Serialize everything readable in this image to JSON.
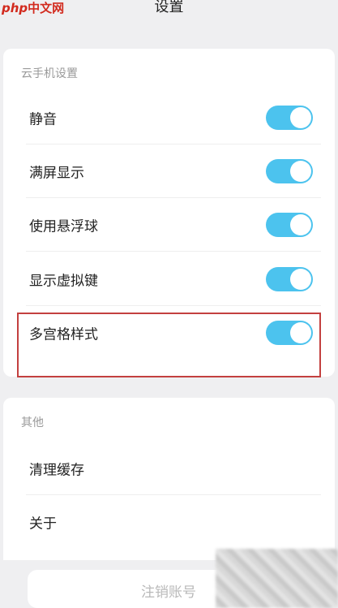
{
  "watermark": {
    "latin": "php",
    "cn": "中文网"
  },
  "header": {
    "title": "设置"
  },
  "section1": {
    "title": "云手机设置",
    "items": [
      {
        "label": "静音",
        "enabled": true
      },
      {
        "label": "满屏显示",
        "enabled": true
      },
      {
        "label": "使用悬浮球",
        "enabled": true
      },
      {
        "label": "显示虚拟键",
        "enabled": true
      },
      {
        "label": "多宫格样式",
        "enabled": true
      }
    ]
  },
  "section2": {
    "title": "其他",
    "items": [
      {
        "label": "清理缓存"
      },
      {
        "label": "关于"
      }
    ]
  },
  "footer": {
    "logout_label": "注销账号"
  },
  "colors": {
    "accent": "#4cc3ee",
    "highlight": "#c3403f"
  }
}
